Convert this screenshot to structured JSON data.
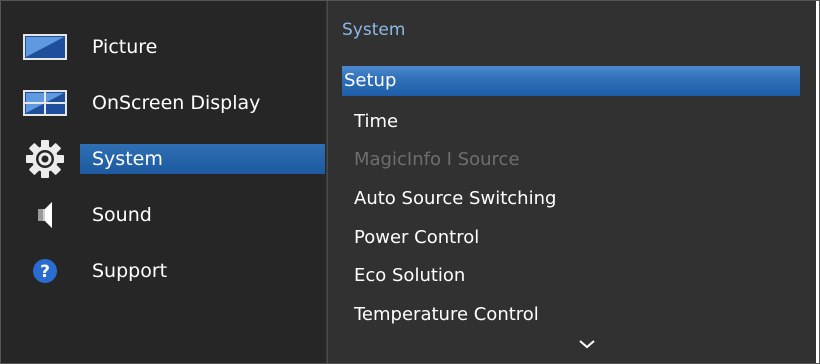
{
  "main_menu": {
    "items": [
      {
        "label": "Picture",
        "icon": "picture-icon"
      },
      {
        "label": "OnScreen Display",
        "icon": "onscreen-display-icon"
      },
      {
        "label": "System",
        "icon": "gear-icon",
        "selected": true
      },
      {
        "label": "Sound",
        "icon": "speaker-icon"
      },
      {
        "label": "Support",
        "icon": "help-icon"
      }
    ]
  },
  "sub_menu": {
    "title": "System",
    "items": [
      {
        "label": "Setup",
        "selected": true
      },
      {
        "label": "Time"
      },
      {
        "label": "MagicInfo I Source",
        "disabled": true
      },
      {
        "label": "Auto Source Switching"
      },
      {
        "label": "Power Control"
      },
      {
        "label": "Eco Solution"
      },
      {
        "label": "Temperature Control"
      }
    ],
    "more_indicator": "chevron-down-icon"
  },
  "colors": {
    "accent": "#1d5aa0",
    "title": "#8fb8e6",
    "disabled_text": "#6e6e6e",
    "left_bg": "#262626",
    "right_bg": "#313131"
  }
}
